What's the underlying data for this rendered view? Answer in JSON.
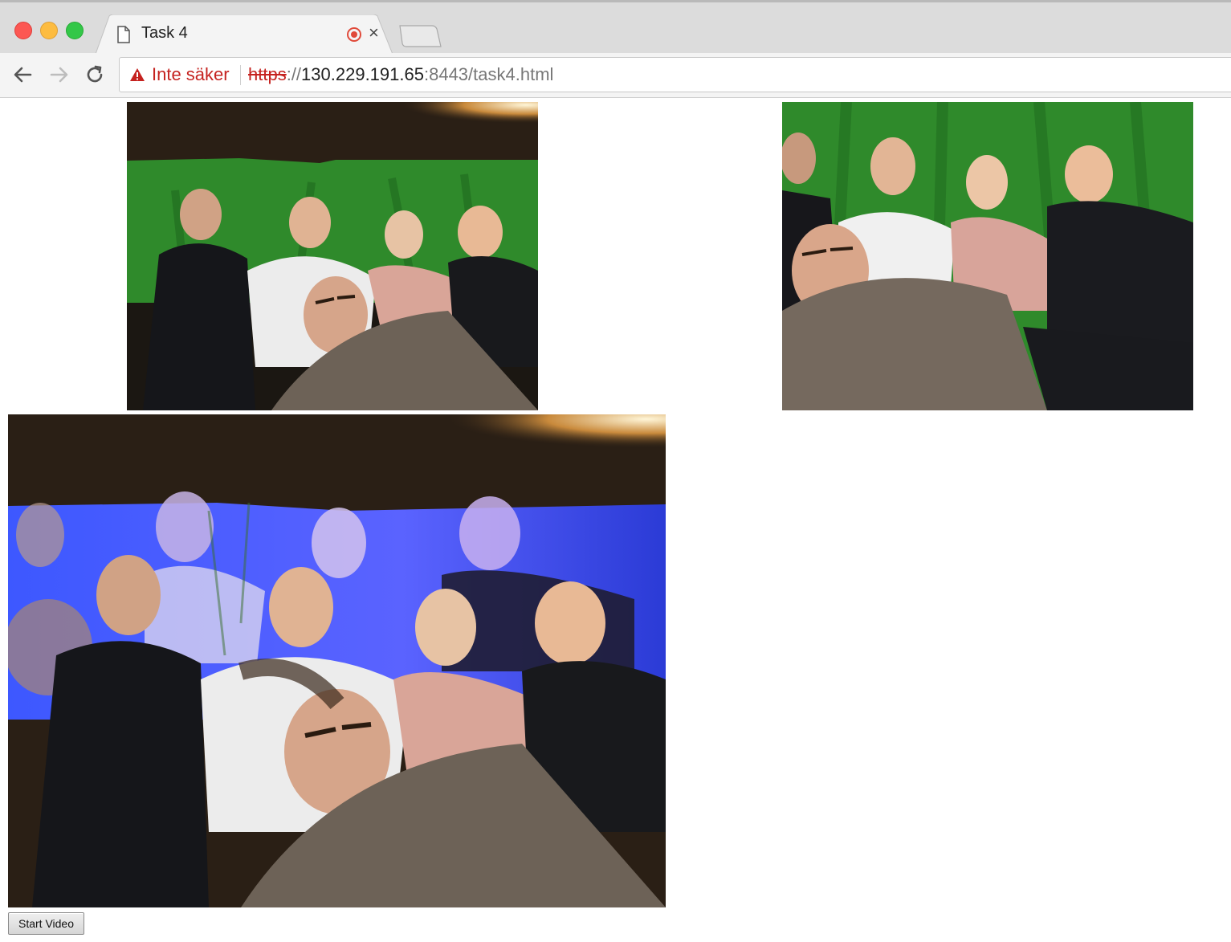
{
  "browser": {
    "tab": {
      "title": "Task 4",
      "icon": "document-icon",
      "recording_indicator": "record-icon"
    },
    "address": {
      "security_label": "Inte säker",
      "url_scheme": "https",
      "url_separator": "://",
      "url_host": "130.229.191.65",
      "url_rest": ":8443/task4.html"
    }
  },
  "page": {
    "start_button_label": "Start Video"
  },
  "colors": {
    "security_warning": "#c5221f",
    "green_screen": "#2f8a2b",
    "replaced_background_blue": "#3b53ff"
  }
}
